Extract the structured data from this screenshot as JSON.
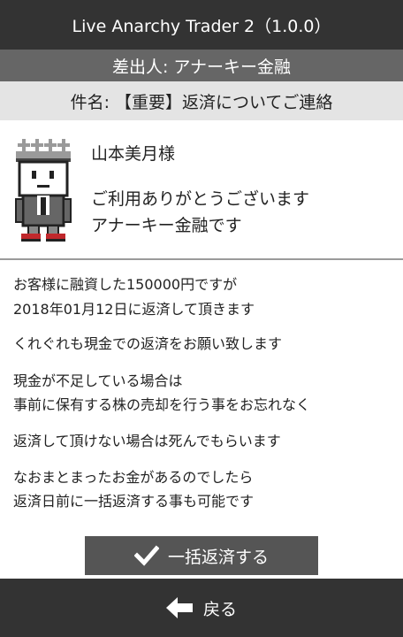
{
  "app": {
    "title": "Live Anarchy Trader 2（1.0.0）"
  },
  "mail": {
    "sender": "差出人: アナーキー金融",
    "subject": "件名: 【重要】返済についてご連絡",
    "recipient": "山本美月様",
    "greeting_lines": [
      "ご利用ありがとうございます",
      "アナーキー金融です"
    ],
    "body_lines": [
      "お客様に融資した150000円ですが",
      "2018年01月12日に返済して頂きます",
      "くれぐれも現金での返済をお願い致します",
      "現金が不足している場合は",
      "事前に保有する株の売却を行う事をお忘れなく",
      "返済して頂けない場合は死んでもらいます",
      "なおまとまったお金があるのでしたら",
      "返済日前に一括返済する事も可能です"
    ]
  },
  "actions": {
    "pay_all_label": "一括返済する",
    "back_label": "戻る"
  },
  "icons": {
    "avatar": "pixel-character-avatar-icon",
    "check": "checkmark-icon",
    "back": "left-arrow-icon"
  },
  "colors": {
    "titlebar": "#333333",
    "sender_bar": "#666666",
    "subject_bar": "#e4e4e4",
    "button": "#555555",
    "shoe_accent": "#c0282c"
  }
}
